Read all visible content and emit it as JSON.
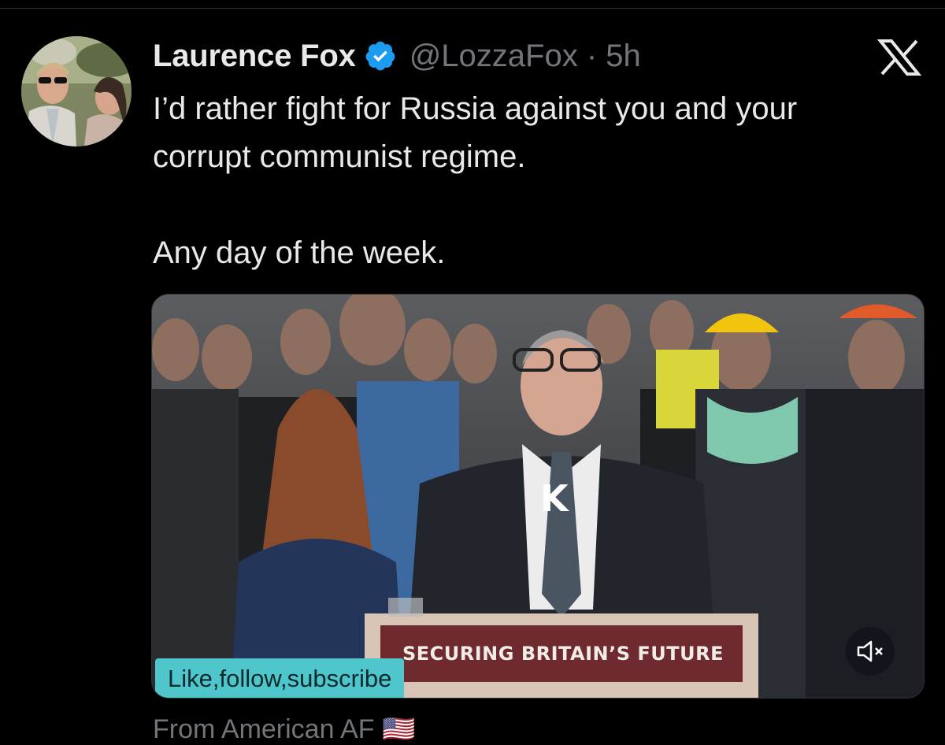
{
  "tweet": {
    "display_name": "Laurence Fox",
    "handle": "@LozzaFox",
    "separator": "·",
    "time": "5h",
    "text_line1": "I’d rather fight for Russia against you and your",
    "text_line2": "corrupt communist regime.",
    "text_line3": "Any day of the week.",
    "verified": true
  },
  "icons": {
    "verified": "verified-badge-icon",
    "platform": "x-logo-icon",
    "mute": "volume-mute-icon"
  },
  "media": {
    "lectern_text": "SECURING BRITAIN’S FUTURE",
    "caption": "Like,follow,subscribe",
    "speaker_badge": "K"
  },
  "source": {
    "text": "From American AF 🇺🇸"
  },
  "colors": {
    "background": "#000000",
    "text": "#e7e9ea",
    "muted": "#71767b",
    "verified": "#1d9bf0",
    "caption_bg": "#4fc6cc",
    "lectern": "#6e2a2e"
  }
}
